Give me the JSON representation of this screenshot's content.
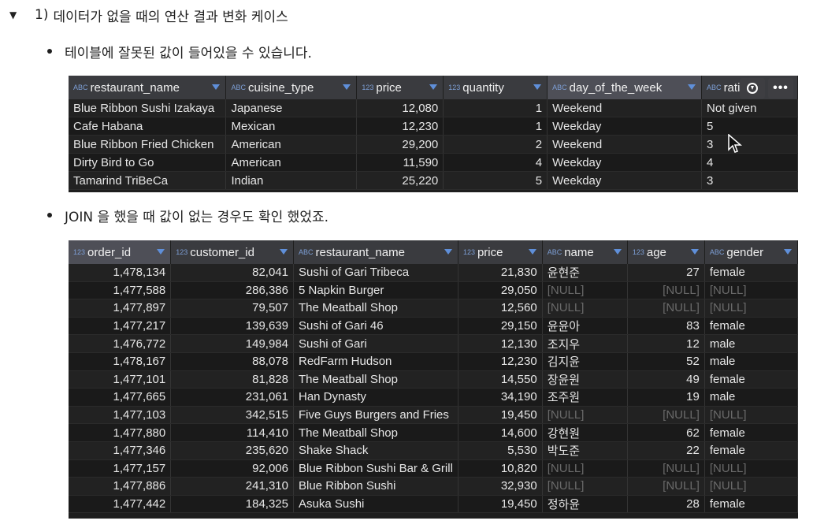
{
  "section": {
    "number": "1)",
    "heading": "데이터가 없을 때의 연산 결과 변화 케이스",
    "bullet1": "테이블에 잘못된 값이 들어있을 수 있습니다.",
    "bullet2": "JOIN 을 했을 때 값이 없는 경우도 확인 했었죠."
  },
  "table1": {
    "columns": [
      {
        "type": "ABC",
        "label": "restaurant_name"
      },
      {
        "type": "ABC",
        "label": "cuisine_type"
      },
      {
        "type": "123",
        "label": "price"
      },
      {
        "type": "123",
        "label": "quantity"
      },
      {
        "type": "ABC",
        "label": "day_of_the_week"
      },
      {
        "type": "ABC",
        "label": "rati"
      }
    ],
    "rows": [
      [
        "Blue Ribbon Sushi Izakaya",
        "Japanese",
        "12,080",
        "1",
        "Weekend",
        "Not given"
      ],
      [
        "Cafe Habana",
        "Mexican",
        "12,230",
        "1",
        "Weekday",
        "5"
      ],
      [
        "Blue Ribbon Fried Chicken",
        "American",
        "29,200",
        "2",
        "Weekend",
        "3"
      ],
      [
        "Dirty Bird to Go",
        "American",
        "11,590",
        "4",
        "Weekday",
        "4"
      ],
      [
        "Tamarind TriBeCa",
        "Indian",
        "25,220",
        "5",
        "Weekday",
        "3"
      ]
    ]
  },
  "table2": {
    "columns": [
      {
        "type": "123",
        "label": "order_id"
      },
      {
        "type": "123",
        "label": "customer_id"
      },
      {
        "type": "ABC",
        "label": "restaurant_name"
      },
      {
        "type": "123",
        "label": "price"
      },
      {
        "type": "ABC",
        "label": "name"
      },
      {
        "type": "123",
        "label": "age"
      },
      {
        "type": "ABC",
        "label": "gender"
      }
    ],
    "rows": [
      [
        "1,478,134",
        "82,041",
        "Sushi of Gari Tribeca",
        "21,830",
        "윤현준",
        "27",
        "female"
      ],
      [
        "1,477,588",
        "286,386",
        "5 Napkin Burger",
        "29,050",
        "[NULL]",
        "[NULL]",
        "[NULL]"
      ],
      [
        "1,477,897",
        "79,507",
        "The Meatball Shop",
        "12,560",
        "[NULL]",
        "[NULL]",
        "[NULL]"
      ],
      [
        "1,477,217",
        "139,639",
        "Sushi of Gari 46",
        "29,150",
        "윤윤아",
        "83",
        "female"
      ],
      [
        "1,476,772",
        "149,984",
        "Sushi of Gari",
        "12,130",
        "조지우",
        "12",
        "male"
      ],
      [
        "1,478,167",
        "88,078",
        "RedFarm Hudson",
        "12,230",
        "김지윤",
        "52",
        "male"
      ],
      [
        "1,477,101",
        "81,828",
        "The Meatball Shop",
        "14,550",
        "장윤원",
        "49",
        "female"
      ],
      [
        "1,477,665",
        "231,061",
        "Han Dynasty",
        "34,190",
        "조주원",
        "19",
        "male"
      ],
      [
        "1,477,103",
        "342,515",
        "Five Guys Burgers and Fries",
        "19,450",
        "[NULL]",
        "[NULL]",
        "[NULL]"
      ],
      [
        "1,477,880",
        "114,410",
        "The Meatball Shop",
        "14,600",
        "강현원",
        "62",
        "female"
      ],
      [
        "1,477,346",
        "235,620",
        "Shake Shack",
        "5,530",
        "박도준",
        "22",
        "female"
      ],
      [
        "1,477,157",
        "92,006",
        "Blue Ribbon Sushi Bar & Grill",
        "10,820",
        "[NULL]",
        "[NULL]",
        "[NULL]"
      ],
      [
        "1,477,886",
        "241,310",
        "Blue Ribbon Sushi",
        "32,930",
        "[NULL]",
        "[NULL]",
        "[NULL]"
      ],
      [
        "1,477,442",
        "184,325",
        "Asuka Sushi",
        "19,450",
        "정하윤",
        "28",
        "female"
      ]
    ]
  },
  "icons": {
    "toggle": "triangle-down-icon",
    "download": "download-icon",
    "more": "more-icon",
    "cursor": "mouse-cursor-icon"
  }
}
